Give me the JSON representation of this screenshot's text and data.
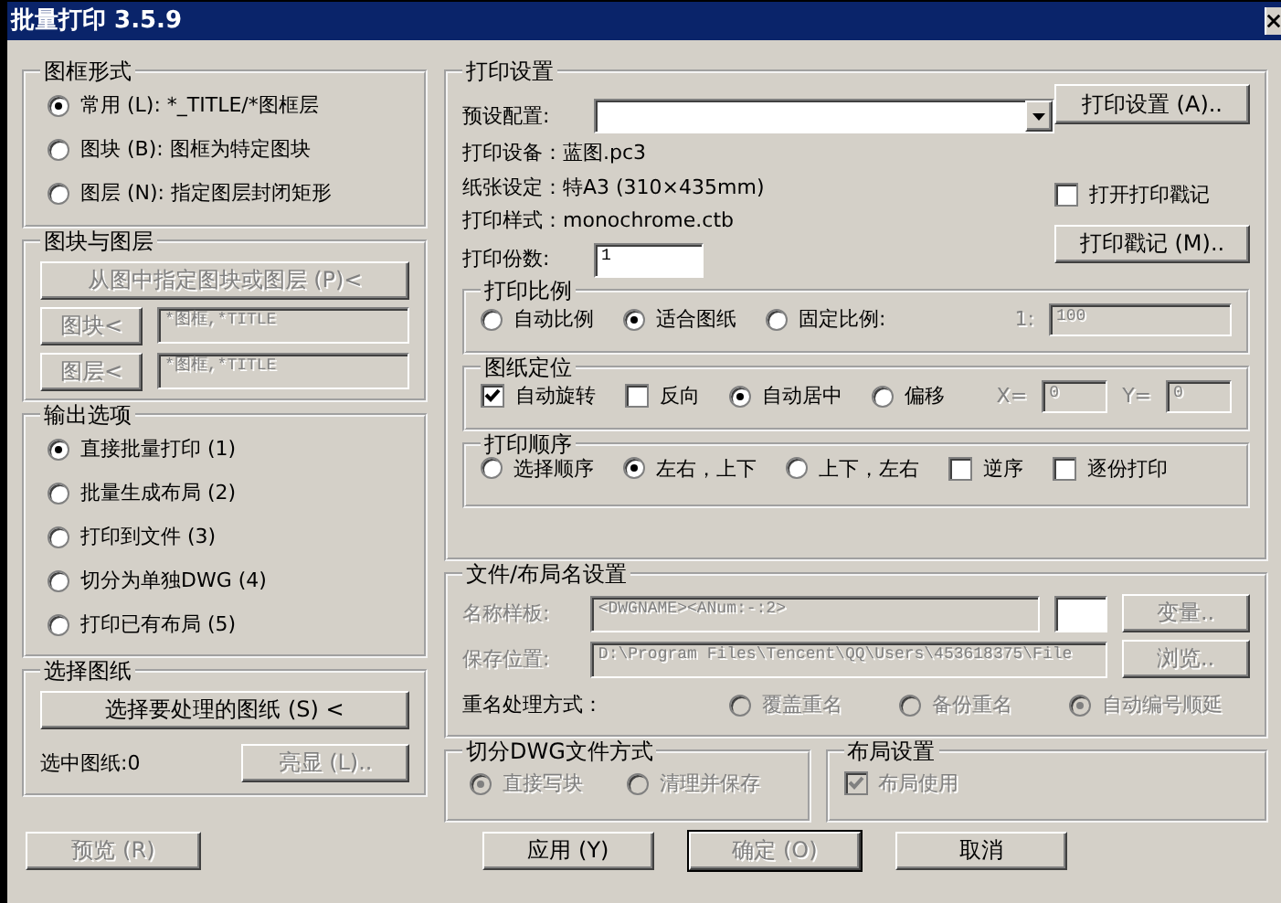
{
  "window": {
    "title": "批量打印 3.5.9"
  },
  "frame_type": {
    "label": "图框形式",
    "options": [
      {
        "label": "常用 (L): *_TITLE/*图框层",
        "selected": true
      },
      {
        "label": "图块 (B): 图框为特定图块",
        "selected": false
      },
      {
        "label": "图层 (N): 指定图层封闭矩形",
        "selected": false
      }
    ]
  },
  "blocks_layers": {
    "label": "图块与图层",
    "pick_button": {
      "label": "从图中指定图块或图层 (P)<",
      "disabled": true
    },
    "rows": [
      {
        "button": {
          "label": "图块<",
          "disabled": true
        },
        "value": "*图框,*TITLE"
      },
      {
        "button": {
          "label": "图层<",
          "disabled": true
        },
        "value": "*图框,*TITLE"
      }
    ]
  },
  "output": {
    "label": "输出选项",
    "options": [
      {
        "label": "直接批量打印 (1)",
        "selected": true
      },
      {
        "label": "批量生成布局 (2)",
        "selected": false
      },
      {
        "label": "打印到文件 (3)",
        "selected": false
      },
      {
        "label": "切分为单独DWG (4)",
        "selected": false
      },
      {
        "label": "打印已有布局 (5)",
        "selected": false
      }
    ]
  },
  "select_sheets": {
    "label": "选择图纸",
    "select_button": {
      "label": "选择要处理的图纸 (S) <",
      "disabled": false
    },
    "count": "选中图纸:0",
    "highlight_button": {
      "label": "亮显 (L)..",
      "disabled": true
    }
  },
  "print_settings": {
    "label": "打印设置",
    "preset_label": "预设配置:",
    "setup_button": {
      "label": "打印设置 (A)..",
      "disabled": false
    },
    "info": [
      "打印设备：蓝图.pc3",
      "纸张设定：特A3 (310×435mm)",
      "打印样式：monochrome.ctb"
    ],
    "copies_label": "打印份数:",
    "copies": "1",
    "stamp": {
      "label": "打开打印戳记",
      "checked": false
    },
    "stamp_button": {
      "label": "打印戳记 (M)..",
      "disabled": false
    },
    "scale": {
      "label": "打印比例",
      "items": [
        {
          "kind": "radio",
          "label": "自动比例",
          "selected": false
        },
        {
          "kind": "radio",
          "label": "适合图纸",
          "selected": true
        },
        {
          "kind": "radio",
          "label": "固定比例:",
          "selected": false
        }
      ],
      "fields": [
        {
          "label": "1:",
          "value": "100"
        }
      ],
      "fields_disabled": true
    },
    "position": {
      "label": "图纸定位",
      "items": [
        {
          "kind": "checkbox",
          "label": "自动旋转",
          "checked": true
        },
        {
          "kind": "checkbox",
          "label": "反向",
          "checked": false
        },
        {
          "kind": "radio",
          "label": "自动居中",
          "selected": true
        },
        {
          "kind": "radio",
          "label": "偏移",
          "selected": false
        }
      ],
      "fields": [
        {
          "label": "X=",
          "value": "0"
        },
        {
          "label": "Y=",
          "value": "0"
        }
      ],
      "fields_disabled": true
    },
    "order": {
      "label": "打印顺序",
      "items": [
        {
          "kind": "radio",
          "label": "选择顺序",
          "selected": false
        },
        {
          "kind": "radio",
          "label": "左右，上下",
          "selected": true
        },
        {
          "kind": "radio",
          "label": "上下，左右",
          "selected": false
        },
        {
          "kind": "checkbox",
          "label": "逆序",
          "checked": false
        },
        {
          "kind": "checkbox",
          "label": "逐份打印",
          "checked": false
        }
      ]
    }
  },
  "file_names": {
    "label": "文件/布局名设置",
    "disabled": true,
    "rows": [
      {
        "label": "名称样板:",
        "value": "<DWGNAME><ANum:-:2>",
        "button": "变量.."
      },
      {
        "label": "保存位置:",
        "value": "D:\\Program Files\\Tencent\\QQ\\Users\\453618375\\File",
        "button": "浏览.."
      }
    ],
    "rename_label": "重名处理方式：",
    "rename_options": [
      {
        "label": "覆盖重名",
        "selected": false
      },
      {
        "label": "备份重名",
        "selected": false
      },
      {
        "label": "自动编号顺延",
        "selected": true
      }
    ]
  },
  "split_dwg": {
    "label": "切分DWG文件方式",
    "disabled": true,
    "options": [
      {
        "label": "直接写块",
        "selected": true
      },
      {
        "label": "清理并保存",
        "selected": false
      }
    ]
  },
  "layout": {
    "label": "布局设置",
    "option": {
      "label": "布局使用",
      "checked": true,
      "disabled": true
    }
  },
  "preview_button": {
    "label": "预览 (R)",
    "disabled": true
  },
  "buttons": [
    {
      "label": "应用 (Y)",
      "disabled": false,
      "default": false
    },
    {
      "label": "确定 (O)",
      "disabled": true,
      "default": true
    },
    {
      "label": "取消",
      "disabled": false,
      "default": false
    }
  ]
}
